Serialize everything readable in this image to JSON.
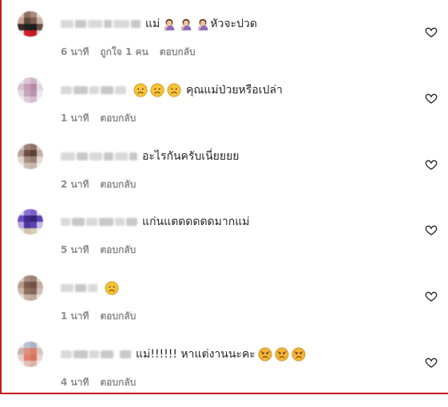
{
  "comments": [
    {
      "text": "แม่",
      "trailing_text": "หัวจะปวด",
      "emojis_before": [],
      "emojis_mid": [
        "facepalm-woman-emoji",
        "facepalm-woman-emoji",
        "facepalm-woman-emoji"
      ],
      "emojis_after": [],
      "time": "6 นาที",
      "likes": "ถูกใจ 1 คน",
      "reply": "ตอบกลับ",
      "avatar_colors": [
        "#d9c3b8",
        "#8c6d60",
        "#a88a7c",
        "#e2d5cd",
        "#c7a595",
        "#5f4740",
        "#7d5d50",
        "#c9b1a6",
        "#3b2b27",
        "#222222",
        "#1c1c1c",
        "#6a4e45",
        "#e8ddd6",
        "#d11f2c",
        "#c21a27",
        "#e0d3cc"
      ]
    },
    {
      "text": "คุณแม่ป่วยหรือเปล่า",
      "trailing_text": "",
      "emojis_before": [
        "sad-face-emoji",
        "sad-face-emoji",
        "sad-face-emoji"
      ],
      "emojis_mid": [],
      "emojis_after": [],
      "time": "1 นาที",
      "likes": "",
      "reply": "ตอบกลับ",
      "avatar_colors": [
        "#e9e4ea",
        "#d9c6d4",
        "#cdb5c6",
        "#eeeaf0",
        "#d6c2d1",
        "#c59eb6",
        "#b88aa6",
        "#e2d8e2",
        "#e4dbe4",
        "#c7a5ba",
        "#b995ae",
        "#ede7ef",
        "#f1eef3",
        "#dccbd8",
        "#d2bcce",
        "#f2eff4"
      ]
    },
    {
      "text": "อะไรกันครับเนี่ยยยย",
      "trailing_text": "",
      "emojis_before": [],
      "emojis_mid": [],
      "emojis_after": [],
      "time": "2 นาที",
      "likes": "",
      "reply": "ตอบกลับ",
      "avatar_colors": [
        "#d5c5bd",
        "#9d8277",
        "#8f7366",
        "#dccdc5",
        "#b9a095",
        "#6c4f44",
        "#5d4238",
        "#c4aea4",
        "#e3d7d0",
        "#a78e84",
        "#9a8076",
        "#e5dad4",
        "#efe9e5",
        "#cdbcb3",
        "#c7b5ab",
        "#f0ebe7"
      ]
    },
    {
      "text": "แก่นแตดดดดดมากแม่",
      "trailing_text": "",
      "emojis_before": [],
      "emojis_mid": [],
      "emojis_after": [],
      "time": "5 นาที",
      "likes": "",
      "reply": "ตอบกลับ",
      "avatar_colors": [
        "#d8d2e8",
        "#8b6fd1",
        "#7d5fc8",
        "#e0dbef",
        "#6b4ec6",
        "#3f2a8c",
        "#35237a",
        "#5b43b0",
        "#b9a8dc",
        "#4c37a3",
        "#5a44b2",
        "#c7bbe4",
        "#e9e5dd",
        "#cfc5a9",
        "#d7ceb6",
        "#f0ede6"
      ]
    },
    {
      "text": "",
      "trailing_text": "",
      "emojis_before": [
        "sad-face-emoji"
      ],
      "emojis_mid": [],
      "emojis_after": [],
      "time": "1 นาที",
      "likes": "",
      "reply": "ตอบกลับ",
      "avatar_colors": [
        "#d8ccc4",
        "#a48c7e",
        "#9a8172",
        "#ddd2cb",
        "#b59a89",
        "#7a5c4c",
        "#6e5243",
        "#c3ab9d",
        "#cbb7ab",
        "#8d7161",
        "#846858",
        "#d2c0b5",
        "#e6ddd7",
        "#c6b2a6",
        "#bfa99c",
        "#ebe4df"
      ]
    },
    {
      "text": "แม่!!!!!! หาแต่งานนะคะ",
      "trailing_text": "",
      "emojis_before": [],
      "emojis_mid": [],
      "emojis_after": [
        "angry-face-emoji",
        "angry-face-emoji",
        "angry-face-emoji"
      ],
      "time": "4 นาที",
      "likes": "",
      "reply": "ตอบกลับ",
      "avatar_colors": [
        "#e6e8ec",
        "#b9c4d2",
        "#aab6c7",
        "#e9ebef",
        "#c9b3a9",
        "#e18f7f",
        "#d9806f",
        "#d7c5bf",
        "#e4cfc9",
        "#e27e6b",
        "#d8735f",
        "#e9d9d4",
        "#efe9e7",
        "#e4bfb6",
        "#ddb3a9",
        "#f1ece9"
      ]
    }
  ]
}
